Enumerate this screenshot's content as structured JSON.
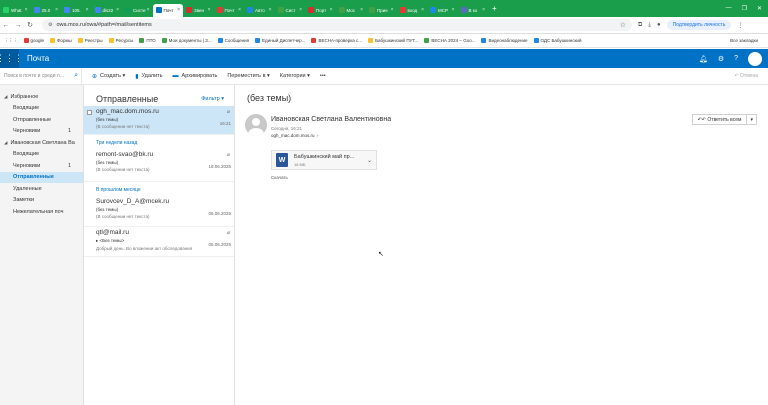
{
  "browser": {
    "tabs": [
      {
        "label": "What",
        "color": "#25d366"
      },
      {
        "label": "25.0",
        "color": "#4285f4"
      },
      {
        "label": "105.",
        "color": "#4285f4"
      },
      {
        "label": "dis22",
        "color": "#4285f4"
      },
      {
        "label": "Cисте",
        "color": "#0f9d58"
      },
      {
        "label": "Почт",
        "color": "#0072c6",
        "active": true
      },
      {
        "label": "Звен",
        "color": "#d32f2f"
      },
      {
        "label": "Почт",
        "color": "#e53935"
      },
      {
        "label": "Авто",
        "color": "#1e88e5"
      },
      {
        "label": "Сист",
        "color": "#43a047"
      },
      {
        "label": "Порт",
        "color": "#d32f2f"
      },
      {
        "label": "Мос",
        "color": "#43a047"
      },
      {
        "label": "Прие",
        "color": "#43a047"
      },
      {
        "label": "вход",
        "color": "#e53935"
      },
      {
        "label": "MCP",
        "color": "#1e88e5"
      },
      {
        "label": "В ко",
        "color": "#5c6bc0"
      }
    ],
    "url": "owa.mos.ru/owa/#path=/mail/sentitems",
    "update_label": "Подтвердить личность",
    "bookmarks": [
      {
        "label": "google",
        "color": "#e53935"
      },
      {
        "label": "Формы",
        "color": "#fbc02d"
      },
      {
        "label": "Реестры",
        "color": "#fbc02d"
      },
      {
        "label": "Ресурсы",
        "color": "#fbc02d"
      },
      {
        "label": "ПТО",
        "color": "#43a047"
      },
      {
        "label": "Мои документы | З...",
        "color": "#43a047"
      },
      {
        "label": "Сообщения",
        "color": "#1e88e5"
      },
      {
        "label": "Единый Диспетчер...",
        "color": "#1e88e5"
      },
      {
        "label": "ВЕСНА-проверка с...",
        "color": "#e53935"
      },
      {
        "label": "Бабушкинский ПУТ...",
        "color": "#fbc02d"
      },
      {
        "label": "ВЕСНА 2024 – Goo...",
        "color": "#43a047"
      },
      {
        "label": "Видеонаблюдение",
        "color": "#1e88e5"
      },
      {
        "label": "ОДС Бабушкинский",
        "color": "#1e88e5"
      }
    ],
    "all_bookmarks": "Все закладки"
  },
  "owa": {
    "app_title": "Почта",
    "search_placeholder": "Поиск в почте и среди л...",
    "commands": {
      "new": "Создать",
      "delete": "Удалить",
      "archive": "Архивировать",
      "move": "Переместить в",
      "categories": "Категории",
      "undo": "Отмена"
    },
    "nav": {
      "favorites": "Избранное",
      "fav_inbox": "Входящие",
      "fav_sent": "Отправленные",
      "fav_drafts": "Черновики",
      "fav_drafts_count": "1",
      "account": "Ивановская Светлана Ва",
      "inbox": "Входящие",
      "drafts": "Черновики",
      "drafts_count": "1",
      "sent": "Отправленные",
      "deleted": "Удаленные",
      "notes": "Заметки",
      "junk": "Нежелательная поч"
    },
    "list": {
      "title": "Отправленные",
      "filter": "Фильтр",
      "section_3weeks": "Три недели назад",
      "section_lastmonth": "В прошлом месяце",
      "messages": [
        {
          "from": "ogh_mac.dom.mos.ru",
          "subject": "(без темы)",
          "preview": "(В сообщении нет текста)",
          "date": "16:21"
        },
        {
          "from": "remont-svao@bk.ru",
          "subject": "(без темы)",
          "preview": "(В сообщении нет текста)",
          "date": "18.06.2025"
        },
        {
          "from": "Surovcev_D_A@mcek.ru",
          "subject": "(без темы)",
          "preview": "(В сообщении нет текста)",
          "date": "05.06.2025"
        },
        {
          "from": "qtl@mail.ru",
          "subject": "<Без темы>",
          "preview": "Добрый день. Во вложении акт обследования",
          "date": "05.06.2025"
        }
      ]
    },
    "reading": {
      "subject": "(без темы)",
      "sender": "Ивановская Светлана Валентиновна",
      "meta": "Сегодня, 16:21",
      "to": "ogh_mac.dom.mos.ru",
      "reply_all": "Ответить всем",
      "attachment_name": "Бабушкинский май пр...",
      "attachment_size": "16 МБ",
      "download": "Скачать"
    }
  }
}
